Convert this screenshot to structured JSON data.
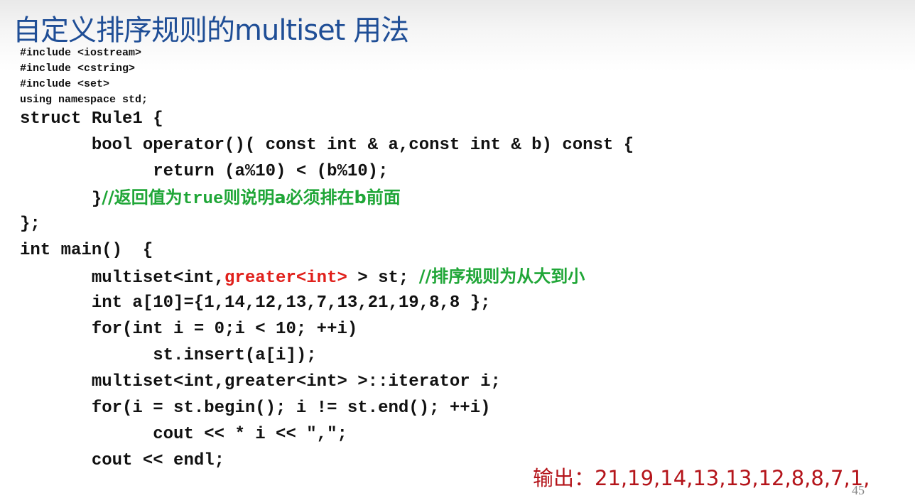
{
  "slide": {
    "title": "自定义排序规则的multiset 用法",
    "includes": [
      "#include <iostream>",
      "#include <cstring>",
      "#include <set>",
      "using namespace std;"
    ],
    "code": {
      "l1": "struct Rule1 {",
      "l2": "       bool operator()( const int & a,const int & b) const {",
      "l3": "             return (a%10) < (b%10);",
      "l4_code": "       }",
      "l4_c1": "//返回值为",
      "l4_c2": "true",
      "l4_c3": "则说明a必须排在b前面",
      "l5": "};",
      "l6": "int main()  {",
      "l7_a": "       multiset<int,",
      "l7_red": "greater<int>",
      "l7_b": " > st; ",
      "l7_comment": "//排序规则为从大到小",
      "l8": "       int a[10]={1,14,12,13,7,13,21,19,8,8 };",
      "l9": "       for(int i = 0;i < 10; ++i)",
      "l10": "             st.insert(a[i]);",
      "l11": "       multiset<int,greater<int> >::iterator i;",
      "l12": "       for(i = st.begin(); i != st.end(); ++i)",
      "l13": "             cout << * i << \",\";",
      "l14": "       cout << endl;"
    },
    "output": "输出：21,19,14,13,13,12,8,8,7,1,",
    "page_number": "45"
  },
  "colors": {
    "title": "#1f4e96",
    "code": "#111111",
    "highlight_red": "#e0201b",
    "comment_green": "#1fa637",
    "output": "#b4141a"
  }
}
